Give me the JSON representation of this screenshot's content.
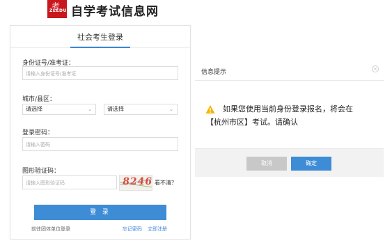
{
  "header": {
    "logo_text": "ZEEDU",
    "logo_mark": "考",
    "site_title": "自学考试信息网"
  },
  "login": {
    "tab_label": "社会考生登录",
    "id_label": "身份证号/准考证：",
    "id_placeholder": "请输入身份证号/准考证",
    "region_label": "城市/县区：",
    "city_select": "请选择",
    "district_select": "请选择",
    "password_label": "登录密码：",
    "password_placeholder": "请输入密码",
    "captcha_label": "图形验证码：",
    "captcha_placeholder": "请输入图形验证码",
    "captcha_value": "8246",
    "refresh_label": "看不清？",
    "login_button": "登 录",
    "group_login_link": "前往团体单位登录",
    "forgot_link": "忘记密码",
    "register_link": "立即注册"
  },
  "dialog": {
    "title": "信息提示",
    "message_line1": "如果您使用当前身份登录报名，将会在",
    "message_line2": "【杭州市区】考试。请确认",
    "cancel_button": "取消",
    "ok_button": "确定"
  },
  "colors": {
    "accent": "#3e8cd6",
    "brand": "#c9171e",
    "warning": "#f5b400"
  }
}
